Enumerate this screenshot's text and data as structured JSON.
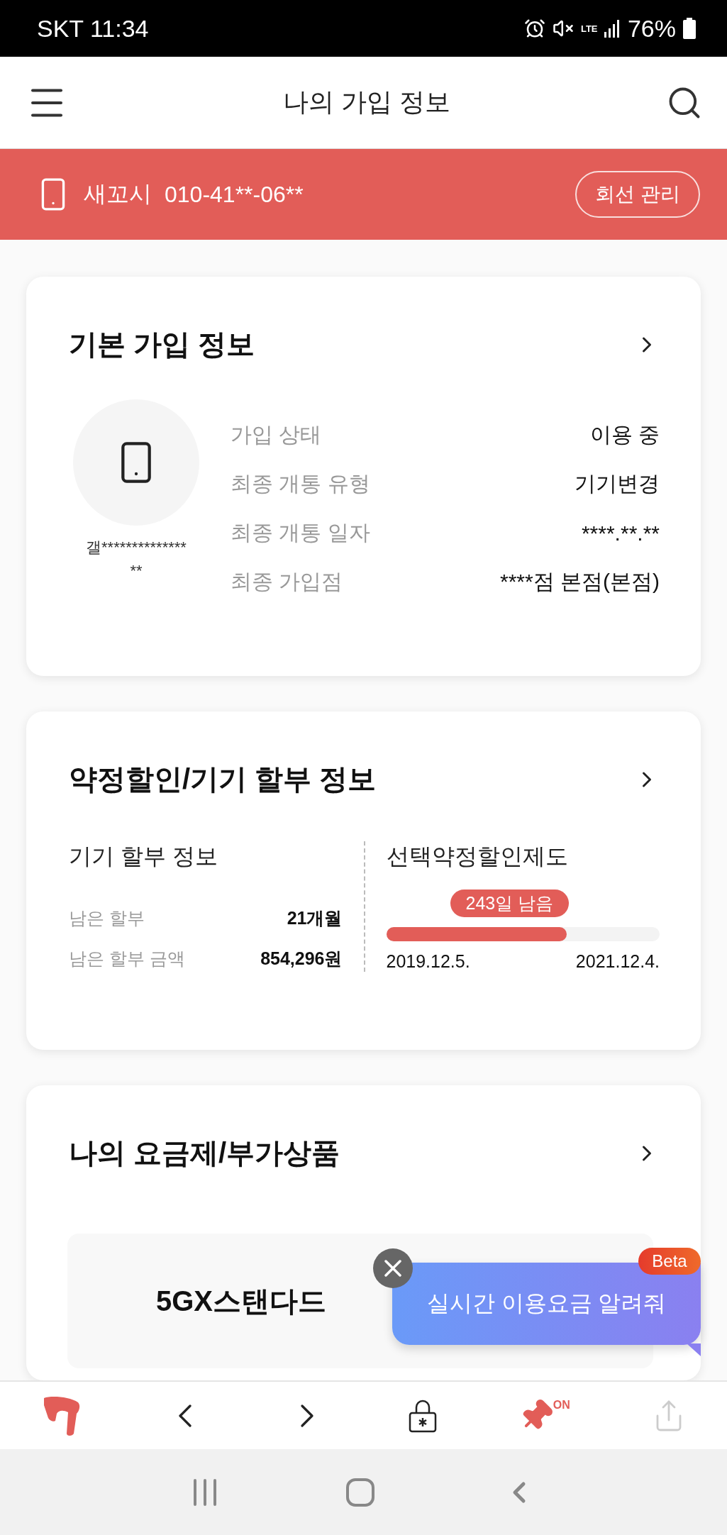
{
  "status_bar": {
    "carrier_time": "SKT 11:34",
    "network": "LTE",
    "battery": "76%"
  },
  "header": {
    "title": "나의 가입 정보"
  },
  "line_bar": {
    "name": "새꼬시",
    "number": "010-41**-06**",
    "button": "회선 관리"
  },
  "basic_info": {
    "title": "기본 가입 정보",
    "device_name_lines": [
      "갤**************",
      "**"
    ],
    "rows": [
      {
        "label": "가입 상태",
        "value": "이용 중"
      },
      {
        "label": "최종 개통 유형",
        "value": "기기변경"
      },
      {
        "label": "최종 개통 일자",
        "value": "****.**.**"
      },
      {
        "label": "최종 가입점",
        "value": "****점 본점(본점)"
      }
    ]
  },
  "installment": {
    "title": "약정할인/기기 할부 정보",
    "left": {
      "title": "기기 할부 정보",
      "rows": [
        {
          "label": "남은 할부",
          "value": "21개월"
        },
        {
          "label": "남은 할부 금액",
          "value": "854,296원"
        }
      ]
    },
    "right": {
      "title": "선택약정할인제도",
      "remaining": "243일 남음",
      "level": 0.66,
      "start": "2019.12.5.",
      "end": "2021.12.4."
    }
  },
  "plans": {
    "title": "나의 요금제/부가상품",
    "plan_name": "5GX스탠다드"
  },
  "popup": {
    "text": "실시간 이용요금 알려줘",
    "badge": "Beta"
  },
  "bottom_nav": {
    "pin_label": "ON",
    "pin_on": true
  }
}
